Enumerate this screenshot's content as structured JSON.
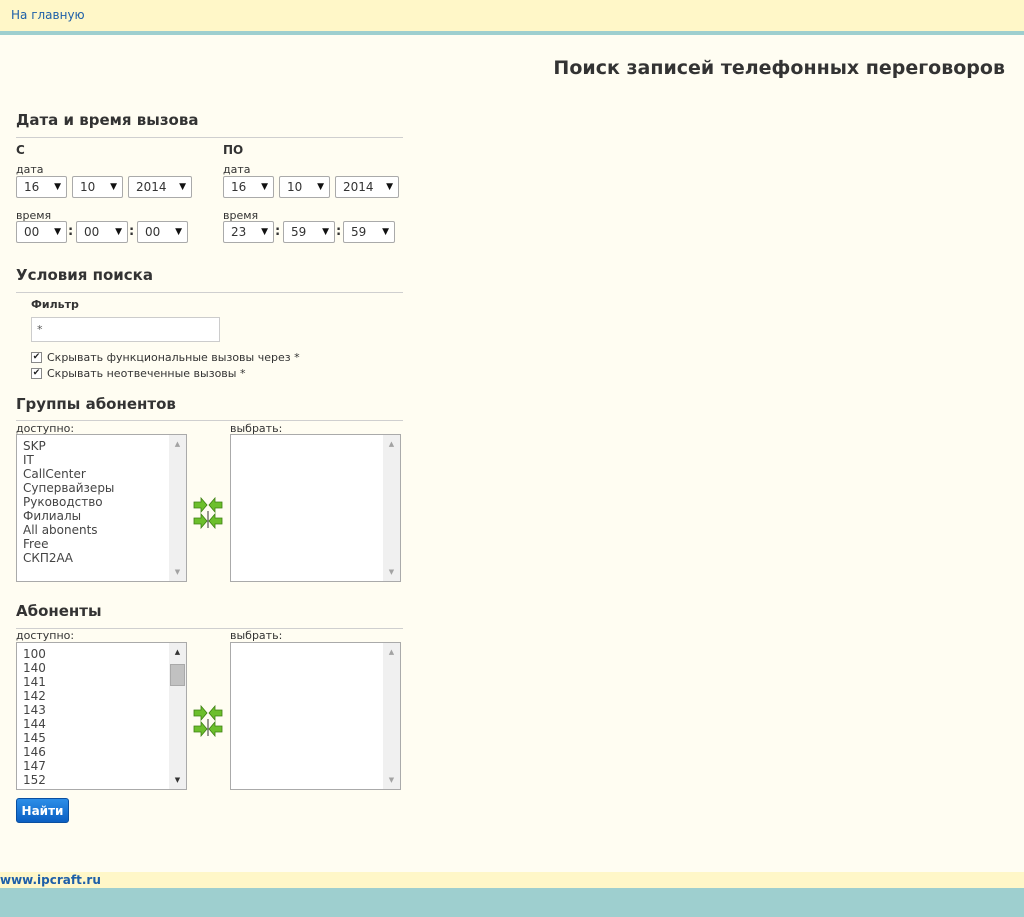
{
  "nav": {
    "home_link": "На главную"
  },
  "page": {
    "title": "Поиск записей телефонных переговоров"
  },
  "datetime": {
    "section_title": "Дата и время вызова",
    "from": {
      "heading": "С",
      "date_label": "дата",
      "day": "16",
      "month": "10",
      "year": "2014",
      "time_label": "время",
      "hour": "00",
      "minute": "00",
      "second": "00"
    },
    "to": {
      "heading": "ПО",
      "date_label": "дата",
      "day": "16",
      "month": "10",
      "year": "2014",
      "time_label": "время",
      "hour": "23",
      "minute": "59",
      "second": "59"
    },
    "time_separator": ":"
  },
  "conditions": {
    "section_title": "Условия поиска",
    "filter_label": "Фильтр",
    "filter_value": "*",
    "checkbox_hide_functional": {
      "label": "Скрывать функциональные вызовы через",
      "checked": true,
      "asterisk": "*"
    },
    "checkbox_hide_unanswered": {
      "label": "Скрывать неотвеченные вызовы",
      "checked": true,
      "asterisk": "*"
    }
  },
  "groups": {
    "section_title": "Группы абонентов",
    "available_label": "доступно:",
    "selected_label": "выбрать:",
    "available": [
      "SKP",
      "IT",
      "CallCenter",
      "Супервайзеры",
      "Руководство",
      "Филиалы",
      "All abonents",
      "Free",
      "СКП2АА"
    ],
    "selected": []
  },
  "abonents": {
    "section_title": "Абоненты",
    "available_label": "доступно:",
    "selected_label": "выбрать:",
    "available": [
      "100",
      "140",
      "141",
      "142",
      "143",
      "144",
      "145",
      "146",
      "147",
      "152"
    ],
    "selected": []
  },
  "actions": {
    "find_button": "Найти"
  },
  "footer": {
    "link": "www.ipcraft.ru"
  },
  "icons": {
    "dropdown": "triangle-down-icon",
    "transfer": "transfer-arrows-icon",
    "check": "checkmark-icon"
  },
  "colors": {
    "top_bar": "#fff7c8",
    "accent_band": "#9ecfcf",
    "page_bg": "#fffdf2",
    "link": "#1e5fa8",
    "button": "#1a74d6",
    "transfer_icon": "#6cbf2c"
  }
}
